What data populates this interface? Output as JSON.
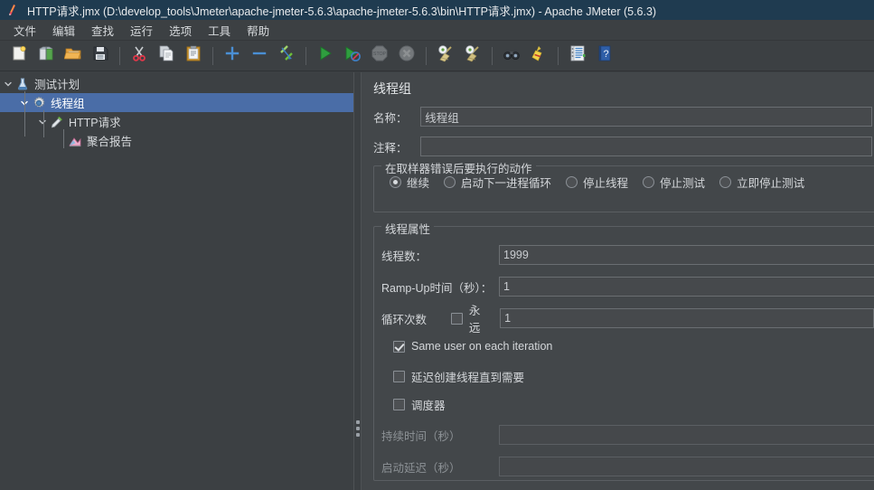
{
  "window": {
    "title": "HTTP请求.jmx (D:\\develop_tools\\Jmeter\\apache-jmeter-5.6.3\\apache-jmeter-5.6.3\\bin\\HTTP请求.jmx) - Apache JMeter (5.6.3)",
    "icon": "jmeter-logo-icon",
    "titlebar_bg": "#1f3b50"
  },
  "menu": {
    "items": [
      {
        "label": "文件",
        "name": "menu-file"
      },
      {
        "label": "编辑",
        "name": "menu-edit"
      },
      {
        "label": "查找",
        "name": "menu-search"
      },
      {
        "label": "运行",
        "name": "menu-run"
      },
      {
        "label": "选项",
        "name": "menu-options"
      },
      {
        "label": "工具",
        "name": "menu-tools"
      },
      {
        "label": "帮助",
        "name": "menu-help"
      }
    ]
  },
  "toolbar": {
    "buttons": [
      {
        "icon": "new-document-icon",
        "name": "toolbar-new",
        "enabled": true
      },
      {
        "icon": "templates-icon",
        "name": "toolbar-templates",
        "enabled": true
      },
      {
        "icon": "open-folder-icon",
        "name": "toolbar-open",
        "enabled": true
      },
      {
        "icon": "save-floppy-icon",
        "name": "toolbar-save",
        "enabled": true
      },
      {
        "icon": "separator",
        "name": "toolbar-separator-1",
        "enabled": true
      },
      {
        "icon": "cut-scissors-icon",
        "name": "toolbar-cut",
        "enabled": true
      },
      {
        "icon": "copy-icon",
        "name": "toolbar-copy",
        "enabled": true
      },
      {
        "icon": "paste-clipboard-icon",
        "name": "toolbar-paste",
        "enabled": true
      },
      {
        "icon": "separator",
        "name": "toolbar-separator-2",
        "enabled": true
      },
      {
        "icon": "plus-expand-icon",
        "name": "toolbar-expand-all",
        "enabled": true
      },
      {
        "icon": "minus-collapse-icon",
        "name": "toolbar-collapse-all",
        "enabled": true
      },
      {
        "icon": "toggle-pencil-icon",
        "name": "toolbar-toggle",
        "enabled": true
      },
      {
        "icon": "separator",
        "name": "toolbar-separator-3",
        "enabled": true
      },
      {
        "icon": "play-start-icon",
        "name": "toolbar-start",
        "enabled": true
      },
      {
        "icon": "play-no-timers-icon",
        "name": "toolbar-start-no-pauses",
        "enabled": true
      },
      {
        "icon": "stop-octagon-icon",
        "name": "toolbar-stop",
        "enabled": false
      },
      {
        "icon": "shutdown-x-icon",
        "name": "toolbar-shutdown",
        "enabled": false
      },
      {
        "icon": "separator",
        "name": "toolbar-separator-4",
        "enabled": true
      },
      {
        "icon": "clear-broom-gear-icon",
        "name": "toolbar-clear",
        "enabled": true
      },
      {
        "icon": "clear-all-broom-icon",
        "name": "toolbar-clear-all",
        "enabled": true
      },
      {
        "icon": "separator",
        "name": "toolbar-separator-5",
        "enabled": true
      },
      {
        "icon": "search-binoculars-icon",
        "name": "toolbar-search",
        "enabled": true
      },
      {
        "icon": "reset-search-broom-icon",
        "name": "toolbar-search-reset",
        "enabled": true
      },
      {
        "icon": "separator",
        "name": "toolbar-separator-6",
        "enabled": true
      },
      {
        "icon": "function-helper-icon",
        "name": "toolbar-function-helper",
        "enabled": true
      },
      {
        "icon": "help-book-icon",
        "name": "toolbar-help",
        "enabled": true
      }
    ]
  },
  "tree": {
    "nodes": [
      {
        "label": "测试计划",
        "icon": "test-plan-beaker-icon",
        "depth": 0,
        "expanded": true,
        "selected": false,
        "name": "tree-node-test-plan"
      },
      {
        "label": "线程组",
        "icon": "thread-group-gear-icon",
        "depth": 1,
        "expanded": true,
        "selected": true,
        "name": "tree-node-thread-group"
      },
      {
        "label": "HTTP请求",
        "icon": "http-sampler-pipette-icon",
        "depth": 2,
        "expanded": true,
        "selected": false,
        "name": "tree-node-http-request"
      },
      {
        "label": "聚合报告",
        "icon": "aggregate-report-chart-icon",
        "depth": 3,
        "expanded": false,
        "selected": false,
        "name": "tree-node-aggregate-report"
      }
    ]
  },
  "panel": {
    "title": "线程组",
    "name_label": "名称：",
    "name_value": "线程组",
    "comment_label": "注释：",
    "comment_value": "",
    "error_action": {
      "group_title": "在取样器错误后要执行的动作",
      "options": [
        {
          "label": "继续",
          "selected": true,
          "name": "radio-continue"
        },
        {
          "label": "启动下一进程循环",
          "selected": false,
          "name": "radio-start-next-loop"
        },
        {
          "label": "停止线程",
          "selected": false,
          "name": "radio-stop-thread"
        },
        {
          "label": "停止测试",
          "selected": false,
          "name": "radio-stop-test"
        },
        {
          "label": "立即停止测试",
          "selected": false,
          "name": "radio-stop-test-now"
        }
      ]
    },
    "thread_properties": {
      "group_title": "线程属性",
      "num_threads_label": "线程数：",
      "num_threads_value": "1999",
      "ramp_up_label": "Ramp-Up时间（秒）：",
      "ramp_up_value": "1",
      "loop_count_label": "循环次数",
      "loop_forever_label": "永远",
      "loop_forever_checked": false,
      "loop_count_value": "1",
      "same_user_label": "Same user on each iteration",
      "same_user_checked": true,
      "delayed_start_label": "延迟创建线程直到需要",
      "delayed_start_checked": false,
      "scheduler_label": "调度器",
      "scheduler_checked": false,
      "duration_label": "持续时间（秒）",
      "duration_value": "",
      "startup_delay_label": "启动延迟（秒）",
      "startup_delay_value": ""
    }
  },
  "colors": {
    "selection": "#4a6da7",
    "titlebar": "#1f3b50",
    "panel_bg": "#43474a",
    "tree_bg": "#3c4043",
    "text": "#d4d7da",
    "disabled_text": "#8d9296"
  }
}
